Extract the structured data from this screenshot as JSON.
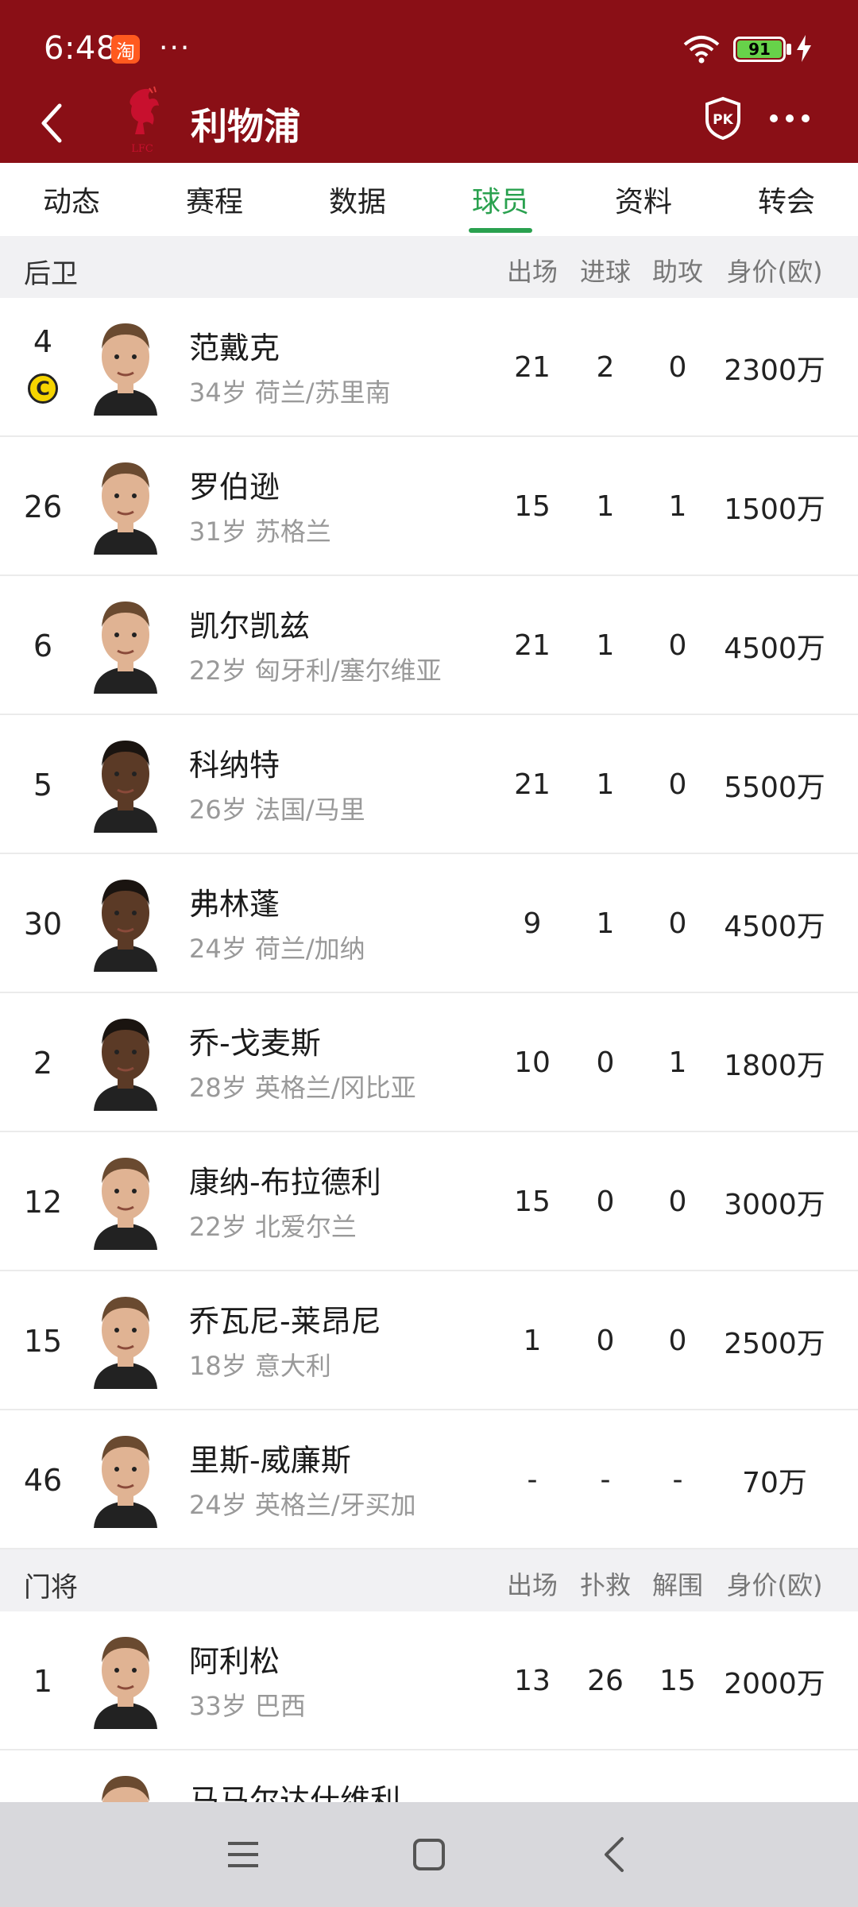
{
  "status_bar": {
    "time": "6:48",
    "badge_text": "淘",
    "more": "···",
    "battery": "91"
  },
  "nav": {
    "title": "利物浦",
    "logo_text": "LFC"
  },
  "tabs": [
    {
      "label": "动态"
    },
    {
      "label": "赛程"
    },
    {
      "label": "数据"
    },
    {
      "label": "球员",
      "active": true
    },
    {
      "label": "资料"
    },
    {
      "label": "转会"
    }
  ],
  "defenders": {
    "title": "后卫",
    "columns": [
      "出场",
      "进球",
      "助攻",
      "身价(欧)"
    ],
    "rows": [
      {
        "number": "4",
        "captain": "C",
        "name": "范戴克",
        "meta": "34岁 荷兰/苏里南",
        "apps": "21",
        "goals": "2",
        "assists": "0",
        "value": "2300万"
      },
      {
        "number": "26",
        "name": "罗伯逊",
        "meta": "31岁 苏格兰",
        "apps": "15",
        "goals": "1",
        "assists": "1",
        "value": "1500万"
      },
      {
        "number": "6",
        "name": "凯尔凯兹",
        "meta": "22岁 匈牙利/塞尔维亚",
        "apps": "21",
        "goals": "1",
        "assists": "0",
        "value": "4500万"
      },
      {
        "number": "5",
        "name": "科纳特",
        "meta": "26岁 法国/马里",
        "apps": "21",
        "goals": "1",
        "assists": "0",
        "value": "5500万"
      },
      {
        "number": "30",
        "name": "弗林蓬",
        "meta": "24岁 荷兰/加纳",
        "apps": "9",
        "goals": "1",
        "assists": "0",
        "value": "4500万"
      },
      {
        "number": "2",
        "name": "乔-戈麦斯",
        "meta": "28岁 英格兰/冈比亚",
        "apps": "10",
        "goals": "0",
        "assists": "1",
        "value": "1800万"
      },
      {
        "number": "12",
        "name": "康纳-布拉德利",
        "meta": "22岁 北爱尔兰",
        "apps": "15",
        "goals": "0",
        "assists": "0",
        "value": "3000万"
      },
      {
        "number": "15",
        "name": "乔瓦尼-莱昂尼",
        "meta": "18岁 意大利",
        "apps": "1",
        "goals": "0",
        "assists": "0",
        "value": "2500万"
      },
      {
        "number": "46",
        "name": "里斯-威廉斯",
        "meta": "24岁 英格兰/牙买加",
        "apps": "-",
        "goals": "-",
        "assists": "-",
        "value": "70万"
      }
    ]
  },
  "goalkeepers": {
    "title": "门将",
    "columns": [
      "出场",
      "扑救",
      "解围",
      "身价(欧)"
    ],
    "rows": [
      {
        "number": "1",
        "name": "阿利松",
        "meta": "33岁 巴西",
        "apps": "13",
        "saves": "26",
        "clearances": "15",
        "value": "2000万"
      },
      {
        "number": "",
        "name": "马马尔达什维利",
        "meta": "",
        "apps": "",
        "saves": "",
        "clearances": "",
        "value": ""
      }
    ]
  },
  "colors": {
    "header": "#8a0f16",
    "accent": "#2aa14f",
    "section_bg": "#f1f1f3"
  }
}
